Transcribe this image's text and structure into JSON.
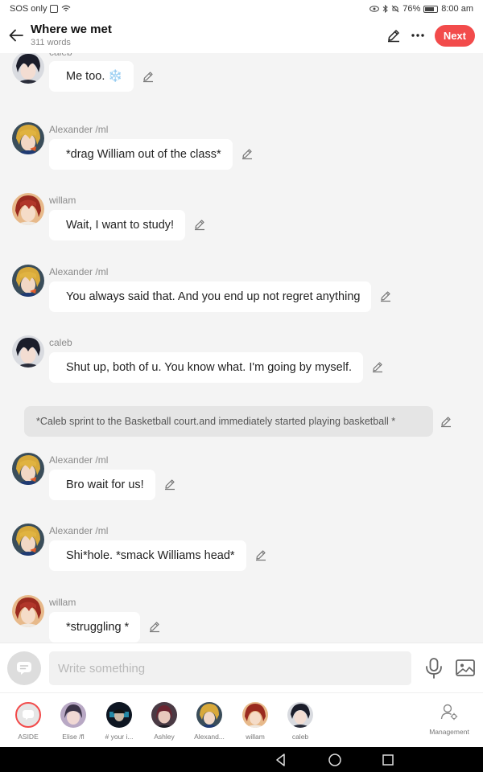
{
  "status_bar": {
    "left_text": "SOS only",
    "battery": "76%",
    "time": "8:00 am"
  },
  "header": {
    "title": "Where we met",
    "word_count": "311 words",
    "next_label": "Next"
  },
  "messages": [
    {
      "sender": "caleb",
      "text": "Me too. ❄️"
    },
    {
      "sender": "Alexander /ml",
      "text": "*drag William out of the class*"
    },
    {
      "sender": "willam",
      "text": "Wait, I want to study!"
    },
    {
      "sender": "Alexander /ml",
      "text": "You always said that. And you end up not regret anything"
    },
    {
      "sender": "caleb",
      "text": "Shut up, both of u. You know what. I'm going by myself."
    },
    {
      "sender": "",
      "text": "*Caleb sprint to the Basketball court.and immediately started playing basketball *"
    },
    {
      "sender": "Alexander /ml",
      "text": "Bro wait for us!"
    },
    {
      "sender": "Alexander /ml",
      "text": "Shi*hole. *smack Williams head*"
    },
    {
      "sender": "willam",
      "text": "*struggling *"
    }
  ],
  "input": {
    "placeholder": "Write something"
  },
  "characters": [
    {
      "label": "ASIDE"
    },
    {
      "label": "Elise /fl"
    },
    {
      "label": "# your i..."
    },
    {
      "label": "Ashley"
    },
    {
      "label": "Alexand..."
    },
    {
      "label": "willam"
    },
    {
      "label": "caleb"
    }
  ],
  "management_label": "Management",
  "colors": {
    "accent": "#f24b4b",
    "background": "#f4f4f4",
    "bubble": "#ffffff",
    "narration": "#e5e5e5"
  },
  "icons": {
    "back": "arrow-left-icon",
    "edit": "pencil-icon",
    "more": "more-dots-icon",
    "mic": "microphone-icon",
    "image": "image-icon",
    "aside": "chat-bubble-icon",
    "management": "person-gear-icon"
  }
}
